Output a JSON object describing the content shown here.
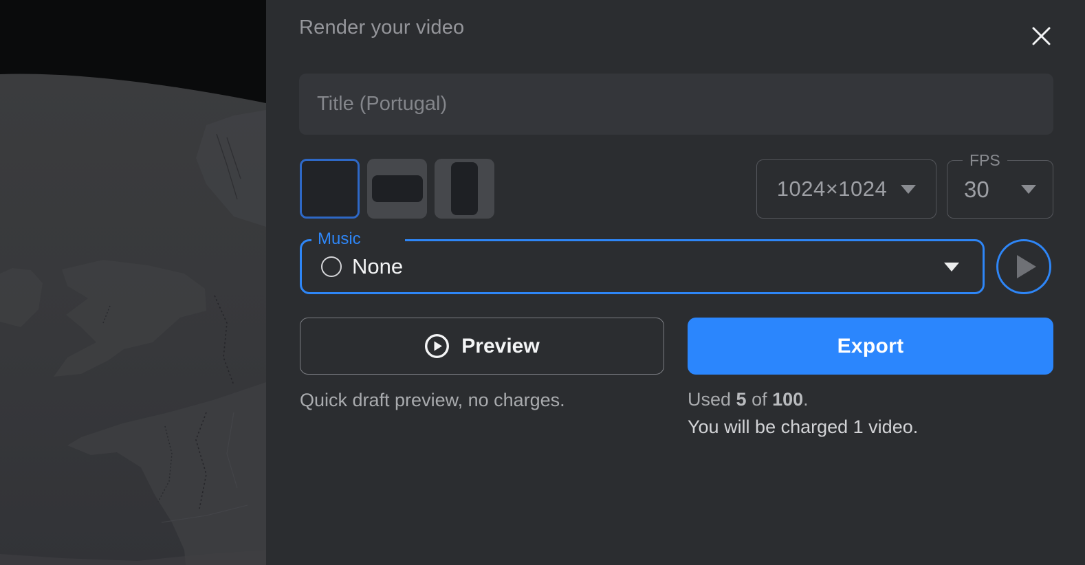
{
  "modal": {
    "title": "Render your video",
    "title_input": {
      "placeholder": "Title (Portugal)",
      "value": ""
    },
    "aspect_ratios": {
      "options": [
        {
          "id": "square",
          "selected": true
        },
        {
          "id": "landscape",
          "selected": false
        },
        {
          "id": "portrait",
          "selected": false
        }
      ]
    },
    "resolution_select": {
      "value": "1024×1024"
    },
    "fps_select": {
      "label": "FPS",
      "value": "30"
    },
    "music_select": {
      "label": "Music",
      "value": "None"
    },
    "buttons": {
      "preview": "Preview",
      "export": "Export"
    },
    "preview_hint": "Quick draft preview, no charges.",
    "usage": {
      "prefix": "Used ",
      "used": "5",
      "middle": " of ",
      "total": "100",
      "suffix": "."
    },
    "charge_note": "You will be charged 1 video."
  },
  "icons": {
    "close_icon": "✕",
    "caret_down_icon": "▾",
    "play_icon": "▶",
    "none_circle_icon": "○"
  },
  "colors": {
    "panel_bg": "#2b2d30",
    "accent_blue": "#2e86f7",
    "export_blue": "#2b86fd",
    "selected_aspect_border": "#2e68c6",
    "input_bg": "#34363a",
    "muted_text": "#9ea0a5"
  }
}
